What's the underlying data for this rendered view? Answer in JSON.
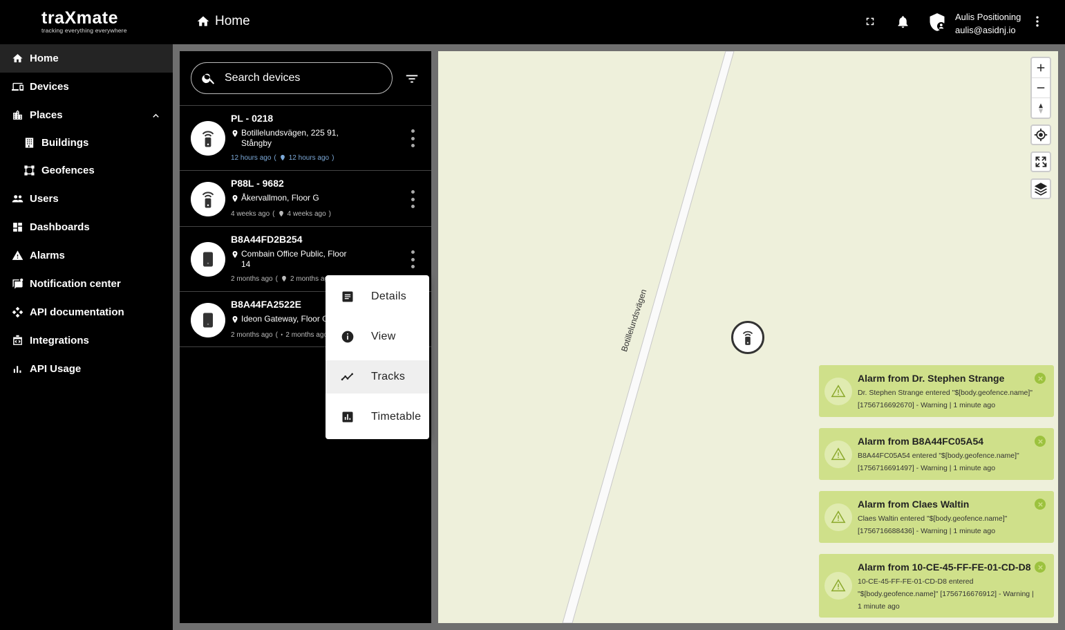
{
  "app": {
    "logo_text": "traXmate",
    "logo_tagline": "tracking everything everywhere"
  },
  "header": {
    "breadcrumb": "Home",
    "user_name": "Aulis Positioning",
    "user_email": "aulis@asidnj.io"
  },
  "sidebar": {
    "items": [
      {
        "label": "Home",
        "icon": "home-icon"
      },
      {
        "label": "Devices",
        "icon": "devices-icon"
      },
      {
        "label": "Places",
        "icon": "places-icon"
      },
      {
        "label": "Buildings",
        "icon": "building-icon"
      },
      {
        "label": "Geofences",
        "icon": "geofence-icon"
      },
      {
        "label": "Users",
        "icon": "users-icon"
      },
      {
        "label": "Dashboards",
        "icon": "dashboard-icon"
      },
      {
        "label": "Alarms",
        "icon": "warning-icon"
      },
      {
        "label": "Notification center",
        "icon": "notification-icon"
      },
      {
        "label": "API documentation",
        "icon": "api-icon"
      },
      {
        "label": "Integrations",
        "icon": "integrations-icon"
      },
      {
        "label": "API Usage",
        "icon": "bar-chart-icon"
      }
    ]
  },
  "search": {
    "placeholder": "Search devices"
  },
  "devices": [
    {
      "name": "PL - 0218",
      "location": "Botillelundsvägen, 225 91, Stångby",
      "time": "12 hours ago",
      "pos_time": "12 hours ago"
    },
    {
      "name": "P88L - 9682",
      "location": "Åkervallmon, Floor G",
      "time": "4 weeks ago",
      "pos_time": "4 weeks ago"
    },
    {
      "name": "B8A44FD2B254",
      "location": "Combain Office Public, Floor 14",
      "time": "2 months ago",
      "pos_time": "2 months ago"
    },
    {
      "name": "B8A44FA2522E",
      "location": "Ideon Gateway, Floor G",
      "time": "2 months ago",
      "pos_time": "2 months ago"
    }
  ],
  "context_menu": {
    "items": [
      {
        "label": "Details",
        "icon": "document-icon"
      },
      {
        "label": "View",
        "icon": "info-icon"
      },
      {
        "label": "Tracks",
        "icon": "timeline-icon"
      },
      {
        "label": "Timetable",
        "icon": "chart-icon"
      }
    ]
  },
  "map": {
    "road_label": "Botillelundsvägen"
  },
  "alarms": [
    {
      "title": "Alarm from Dr. Stephen Strange",
      "line1": "Dr. Stephen Strange entered \"$[body.geofence.name]\"",
      "line2": "[1756716692670] - Warning | 1 minute ago"
    },
    {
      "title": "Alarm from B8A44FC05A54",
      "line1": "B8A44FC05A54 entered \"$[body.geofence.name]\"",
      "line2": "[1756716691497] - Warning | 1 minute ago"
    },
    {
      "title": "Alarm from Claes Waltin",
      "line1": "Claes Waltin entered \"$[body.geofence.name]\"",
      "line2": "[1756716688436] - Warning | 1 minute ago"
    },
    {
      "title": "Alarm from 10-CE-45-FF-FE-01-CD-D8",
      "line1": "10-CE-45-FF-FE-01-CD-D8 entered",
      "line2": "\"$[body.geofence.name]\" [1756716676912] - Warning |",
      "line3": "1 minute ago"
    }
  ],
  "colors": {
    "alarm_bg": "#cfe08a",
    "map_bg": "#eef0db",
    "accent_blue": "#7ca9d8"
  }
}
